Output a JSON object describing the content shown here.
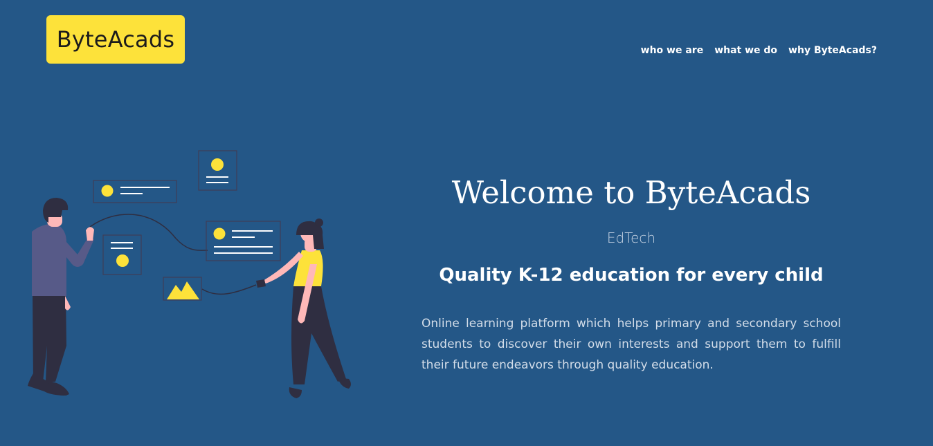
{
  "header": {
    "logo_text": "ByteAcads",
    "nav": [
      {
        "label": "who we are"
      },
      {
        "label": "what we do"
      },
      {
        "label": "why ByteAcads?"
      }
    ]
  },
  "hero": {
    "title": "Welcome to ByteAcads",
    "tag": "EdTech",
    "subtitle": "Quality K-12 education for every child",
    "description": "Online learning platform which helps primary and secondary school students to discover their own interests and support them to fulfill their future endeavors through quality education."
  },
  "colors": {
    "background": "#245787",
    "brand_yellow": "#fde23a",
    "text_white": "#ffffff",
    "illustration_dark": "#2f2e41"
  },
  "illustration": {
    "name": "people-with-floating-content-cards-illustration"
  }
}
